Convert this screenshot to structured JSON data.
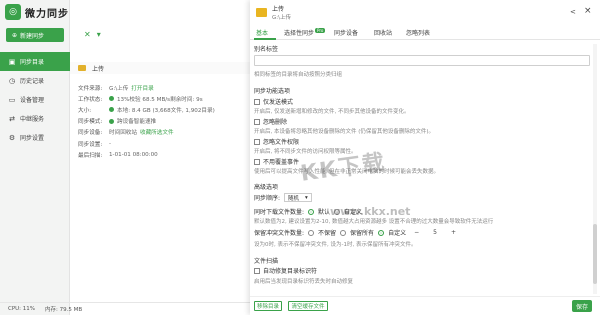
{
  "app": {
    "name": "微力同步",
    "new_sync": "新建同步",
    "nav": [
      "同步目录",
      "历史记录",
      "设备管理",
      "中继服务",
      "同步设置"
    ],
    "status": {
      "cpu": "CPU: 11%",
      "memory": "内存: 79.5 MB"
    }
  },
  "folder": {
    "name": "上传",
    "details": [
      {
        "key": "文件来源:",
        "val": "G:\\上传",
        "extra": "打开目录"
      },
      {
        "key": "工作状态:",
        "val": "13%校验  68.5 MB/s剩余时间: 9s"
      },
      {
        "key": "大小:",
        "val": "本地: 8.4 GB (3,668文件, 1,902目录)"
      },
      {
        "key": "同步模式:",
        "val": "跨设备智能速推"
      },
      {
        "key": "同步设备:",
        "val": "时间回收站",
        "extra": "收藏所选文件"
      },
      {
        "key": "同步设置:",
        "val": "-"
      },
      {
        "key": "最后扫描:",
        "val": "1-01-01 08:00:00"
      }
    ]
  },
  "panel": {
    "title": "上传",
    "path": "G:\\上传",
    "tabs": [
      "基本",
      "选择性同步",
      "同步设备",
      "回收站",
      "忽略列表"
    ],
    "pro_badge": "Pro",
    "alias_label": "别名标签",
    "alias_desc": "相同标签的目录将自动按照分类归组",
    "func_title": "同步功能选项",
    "options": [
      {
        "label": "仅发送模式",
        "desc": "开启后, 仅发送新增和修改的文件, 不同步其他设备的文件变化。"
      },
      {
        "label": "忽略删除",
        "desc": "开启后, 本设备将忽略其他设备删除的文件 (仍保留其他设备删除的文件)。"
      },
      {
        "label": "忽略文件权限",
        "desc": "开启后, 将不同步文件的访问权限等属性。"
      },
      {
        "label": "不用覆盖事件",
        "desc": "使用后可以提高文件写入性能, 但在非正常关闭电脑的时候可能会丢失数据。"
      }
    ],
    "advanced_title": "高级选项",
    "order_label": "同步顺序:",
    "order_value": "随机",
    "concurrent_label": "同时下载文件数量:",
    "concurrent_default": "默认",
    "concurrent_custom": "自定义",
    "concurrent_desc": "默认数值为2, 建议设置为2-10, 数值越大占用资源越多 设置不合理的过大数量会导致软件无法运行",
    "keep_label": "保留冲突文件数量:",
    "keep_opts": [
      "不保留",
      "保留所有",
      "自定义"
    ],
    "keep_value": "5",
    "keep_minus": "−",
    "keep_plus": "+",
    "keep_desc": "设为0时, 表示不保留冲突文件, 设为-1时, 表示保留所有冲突文件。",
    "scan_title": "文件扫描",
    "scan_auto": "自动修复目录标识符",
    "scan_desc": "启用后当发现目录标识符丢失时自动修复",
    "btn_remove": "移除目录",
    "btn_clear": "清空缓存文件",
    "btn_ok": "保存"
  },
  "watermark": {
    "text": "KK下载",
    "url": "www.kkx.net"
  },
  "colors": {
    "accent": "#3aa24a",
    "folder": "#e9b521"
  }
}
